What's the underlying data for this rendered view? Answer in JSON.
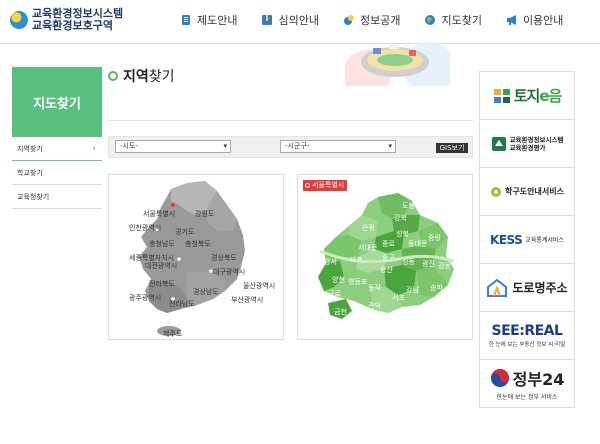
{
  "header": {
    "logo": {
      "line1": "교육환경정보시스템",
      "line2": "교육환경보호구역"
    },
    "nav": [
      {
        "label": "제도안내",
        "icon": "document-icon"
      },
      {
        "label": "심의안내",
        "icon": "book-icon"
      },
      {
        "label": "정보공개",
        "icon": "coins-icon"
      },
      {
        "label": "지도찾기",
        "icon": "globe-icon"
      },
      {
        "label": "이용안내",
        "icon": "megaphone-icon"
      }
    ]
  },
  "sidebar": {
    "title": "지도찾기",
    "items": [
      {
        "label": "지역찾기",
        "active": true
      },
      {
        "label": "학교찾기",
        "active": false
      },
      {
        "label": "교육청찾기",
        "active": false
      }
    ]
  },
  "main": {
    "title_bold": "지역",
    "title_rest": "찾기",
    "filters": {
      "sido_value": "-시도-",
      "sigungu_value": "-시군구-",
      "gis_button": "GIS보기"
    },
    "korea_map": {
      "labels": [
        "서울특별시",
        "강원도",
        "인천광역시",
        "경기도",
        "충청남도",
        "충청북도",
        "세종특별자치시",
        "대전광역시",
        "경상북도",
        "대구광역시",
        "전라북도",
        "울산광역시",
        "경상남도",
        "광주광역시",
        "전라남도",
        "부산광역시",
        "제주도"
      ]
    },
    "seoul_map": {
      "badge": "서울특별시",
      "districts": [
        "도봉",
        "노원",
        "강북",
        "은평",
        "성북",
        "중랑",
        "종로",
        "서대문",
        "동대문",
        "마포",
        "중구",
        "광진",
        "강서",
        "용산",
        "성동",
        "양천",
        "영등포",
        "동작",
        "강남",
        "송파",
        "강동",
        "구로",
        "금천",
        "관악",
        "서초"
      ]
    }
  },
  "banners": [
    {
      "name": "tojieum",
      "main_a": "토지",
      "main_b": "e음"
    },
    {
      "name": "edu-env-eval",
      "line1": "교육환경정보시스템",
      "line2": "교육환경평가"
    },
    {
      "name": "school-guide",
      "main": "학구도안내서비스"
    },
    {
      "name": "kess",
      "main": "KESS",
      "sub": "교육통계서비스"
    },
    {
      "name": "road-address",
      "main": "도로명주소"
    },
    {
      "name": "seereal",
      "main": "SEE:REAL",
      "sub": "한 눈에 보는 부동산 정보 씨:리얼"
    },
    {
      "name": "gov24",
      "main": "정부24",
      "sub": "한눈에 보는 정부 서비스"
    }
  ],
  "colors": {
    "accent_green": "#58bf7e",
    "map_gray": "#9a9a9a",
    "map_green_light": "#8dce7e",
    "map_green_dark": "#4aa53f",
    "badge_red": "#e23b3b"
  }
}
